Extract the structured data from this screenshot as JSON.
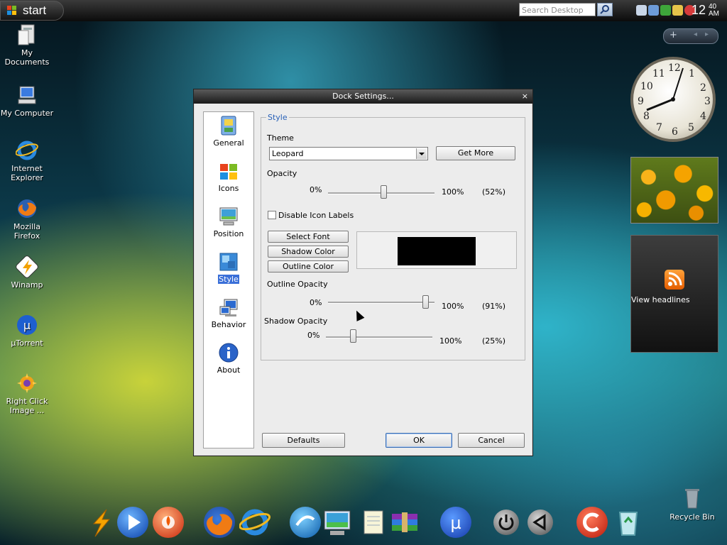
{
  "taskbar": {
    "start_label": "start",
    "search_placeholder": "Search Desktop",
    "clock_hour": "12",
    "clock_minute": "40",
    "clock_ampm": "AM"
  },
  "desktop_icons": [
    {
      "label": "My Documents",
      "icon": "folder-icon"
    },
    {
      "label": "My Computer",
      "icon": "computer-icon"
    },
    {
      "label": "Internet Explorer",
      "icon": "internet-explorer-icon"
    },
    {
      "label": "Mozilla Firefox",
      "icon": "firefox-icon"
    },
    {
      "label": "Winamp",
      "icon": "winamp-icon"
    },
    {
      "label": "µTorrent",
      "icon": "utorrent-icon"
    },
    {
      "label": "Right Click Image ...",
      "icon": "right-click-image-icon"
    }
  ],
  "sidebar": {
    "rss_label": "View headlines"
  },
  "dialog": {
    "title": "Dock Settings...",
    "close": "×",
    "nav": [
      {
        "label": "General",
        "icon": "general-icon"
      },
      {
        "label": "Icons",
        "icon": "windows-logo-icon"
      },
      {
        "label": "Position",
        "icon": "position-icon"
      },
      {
        "label": "Style",
        "icon": "style-icon",
        "selected": true
      },
      {
        "label": "Behavior",
        "icon": "behavior-icon"
      },
      {
        "label": "About",
        "icon": "info-icon"
      }
    ],
    "style_group_title": "Style",
    "theme_label": "Theme",
    "theme_value": "Leopard",
    "get_more_label": "Get More",
    "opacity_label": "Opacity",
    "opacity_min": "0%",
    "opacity_max": "100%",
    "opacity_value": "(52%)",
    "opacity_fraction": 0.52,
    "disable_labels": "Disable Icon Labels",
    "disable_labels_checked": false,
    "select_font_label": "Select Font",
    "shadow_color_label": "Shadow Color",
    "outline_color_label": "Outline Color",
    "preview_color": "#000000",
    "outline_opacity_label": "Outline Opacity",
    "outline_min": "0%",
    "outline_max": "100%",
    "outline_value": "(91%)",
    "outline_fraction": 0.91,
    "shadow_opacity_label": "Shadow Opacity",
    "shadow_min": "0%",
    "shadow_max": "100%",
    "shadow_value": "(25%)",
    "shadow_fraction": 0.25,
    "defaults_label": "Defaults",
    "ok_label": "OK",
    "cancel_label": "Cancel"
  },
  "recycle_bin_label": "Recycle Bin",
  "dock_icons": [
    "winamp-bolt-icon",
    "media-player-icon",
    "burn-icon",
    "firefox-icon",
    "internet-explorer-icon",
    "messenger-icon",
    "monitor-icon",
    "notepad-icon",
    "winrar-icon",
    "utorrent-icon",
    "power-icon",
    "back-icon",
    "ccleaner-icon",
    "recycle-bin-icon"
  ]
}
